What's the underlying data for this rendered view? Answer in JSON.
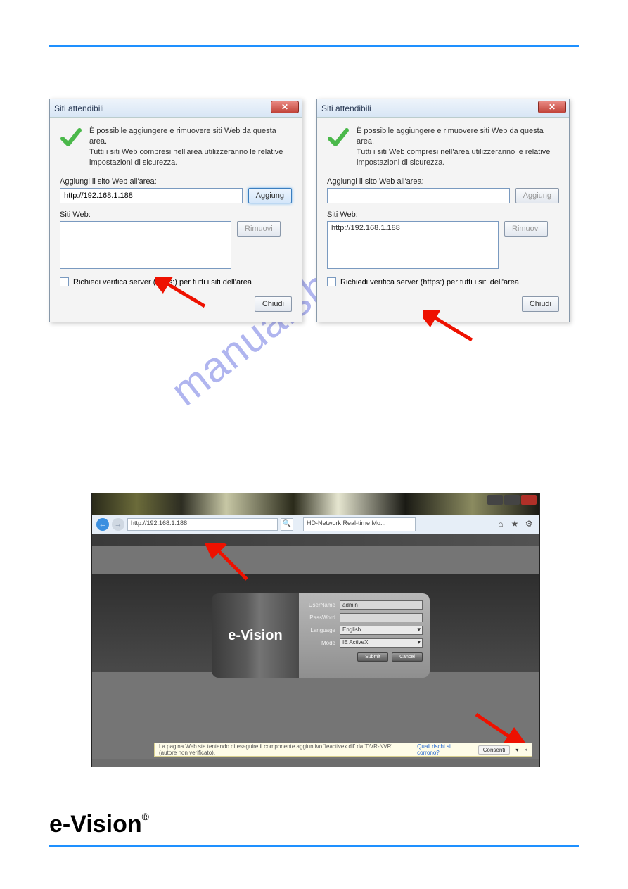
{
  "watermark": "manualshive.com",
  "dialog_common": {
    "title": "Siti attendibili",
    "close_glyph": "✕",
    "info_line1": "È possibile aggiungere e rimuovere siti Web da questa area.",
    "info_line2": "Tutti i siti Web compresi nell'area utilizzeranno le relative impostazioni di sicurezza.",
    "add_site_label": "Aggiungi il sito Web all'area:",
    "websites_label": "Siti Web:",
    "add_button": "Aggiung",
    "remove_button": "Rimuovi",
    "https_check": "Richiedi verifica server (https:) per tutti i siti dell'area",
    "close_button": "Chiudi"
  },
  "dialog1": {
    "input_value": "http://192.168.1.188",
    "list_item": ""
  },
  "dialog2": {
    "input_value": "",
    "list_item": "http://192.168.1.188"
  },
  "browser": {
    "address": "http://192.168.1.188",
    "search_glyph": "🔍",
    "back_glyph": "←",
    "fwd_glyph": "→",
    "tab_title": "HD-Network Real-time Mo...",
    "icons": {
      "home": "⌂",
      "star": "★",
      "gear": "⚙"
    },
    "login": {
      "brand": "e-Vision",
      "labels": {
        "username": "UserName",
        "password": "PassWord",
        "language": "Language",
        "mode": "Mode"
      },
      "values": {
        "username": "admin",
        "password": "",
        "language": "English",
        "mode": "IE ActiveX"
      },
      "buttons": {
        "submit": "Submit",
        "cancel": "Cancel"
      }
    },
    "infobar": {
      "text": "La pagina Web sta tentando di eseguire il componente aggiuntivo 'Ieactivex.dll' da 'DVR-NVR' (autore non verificato).",
      "link": "Quali rischi si corrono?",
      "consent": "Consenti",
      "caret": "▾",
      "x": "×"
    }
  },
  "logo": {
    "e": "e",
    "dash": "-",
    "vision": "Vision",
    "reg": "®"
  }
}
